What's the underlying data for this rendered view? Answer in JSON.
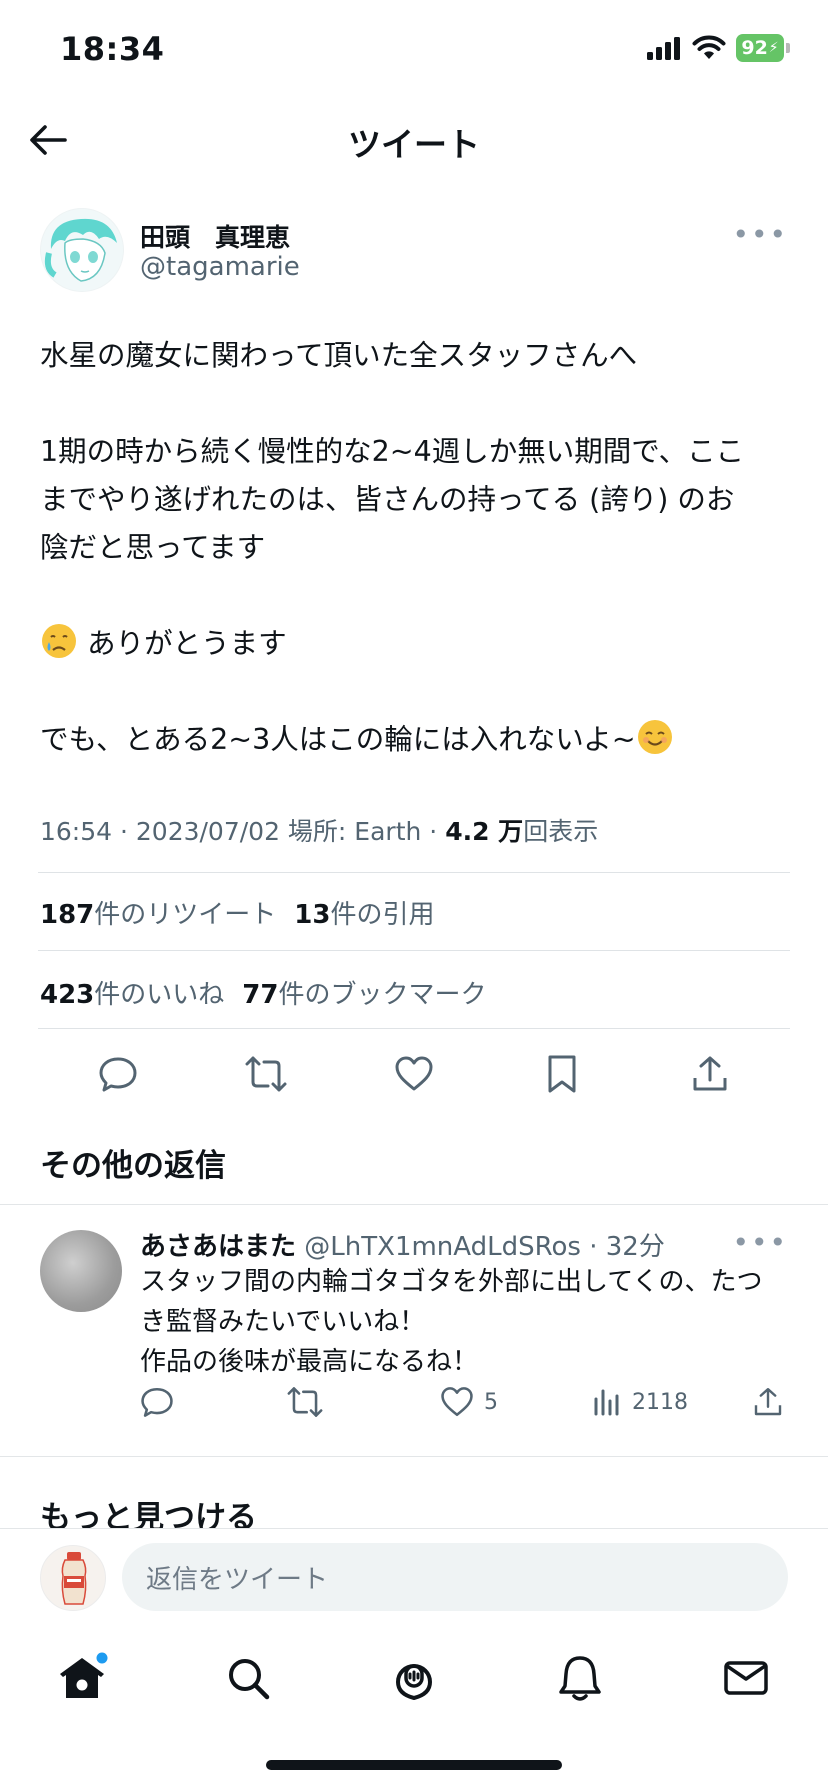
{
  "status_bar": {
    "time": "18:34",
    "battery": "92"
  },
  "header": {
    "title": "ツイート"
  },
  "tweet": {
    "author_name": "田頭　真理恵",
    "author_handle": "@tagamarie",
    "lines": {
      "l1": "水星の魔女に関わって頂いた全スタッフさんへ",
      "l2": "1期の時から続く慢性的な2~4週しか無い期間で、ここ",
      "l3": "までやり遂げれたのは、皆さんの持ってる (誇り) のお",
      "l4": "陰だと思ってます",
      "l5": "ありがとうます",
      "l6": "でも、とある2~3人はこの輪には入れないよ~"
    },
    "meta_prefix": "16:54 · 2023/07/02 場所: Earth · ",
    "views_count": "4.2 万",
    "views_label": "回表示",
    "retweets_count": "187",
    "retweets_label": "件のリツイート",
    "quotes_count": "13",
    "quotes_label": "件の引用",
    "likes_count": "423",
    "likes_label": "件のいいね",
    "bookmarks_count": "77",
    "bookmarks_label": "件のブックマーク"
  },
  "replies_section": {
    "title": "その他の返信"
  },
  "reply": {
    "name": "あさあはまた",
    "handle": "@LhTX1mnAdLdSRos",
    "time": "· 32分",
    "lines": {
      "l1": "スタッフ間の内輪ゴタゴタを外部に出してくの、たつ",
      "l2": "き監督みたいでいいね！",
      "l3": "作品の後味が最高になるね！"
    },
    "likes": "5",
    "views": "2118"
  },
  "discover": {
    "title": "もっと見つける"
  },
  "composer": {
    "placeholder": "返信をツイート"
  },
  "icons": {
    "back": "arrow-left-icon",
    "more": "more-horizontal-icon",
    "reply": "comment-icon",
    "retweet": "retweet-icon",
    "like": "heart-icon",
    "bookmark": "bookmark-icon",
    "share": "share-icon",
    "views": "bar-chart-icon",
    "home": "home-icon",
    "search": "search-icon",
    "spaces": "spaces-icon",
    "notifications": "bell-icon",
    "messages": "mail-icon"
  },
  "colors": {
    "accent": "#1d9bf0",
    "text": "#0f1419",
    "muted": "#536471",
    "battery": "#65c466"
  }
}
